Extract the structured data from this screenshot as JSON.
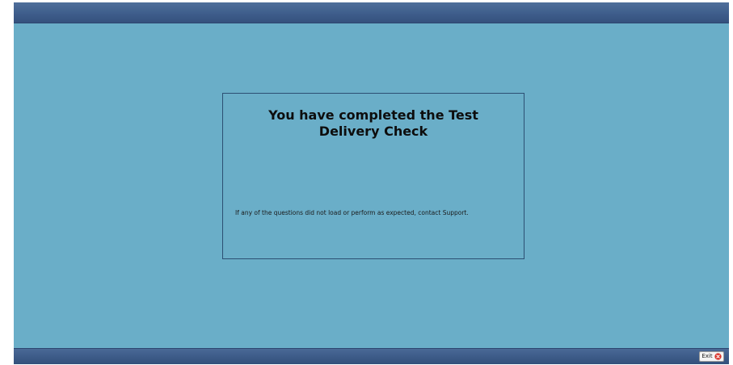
{
  "message": {
    "title": "You have completed the Test Delivery Check",
    "body": "If any of the questions did not load or perform as expected, contact Support."
  },
  "footer": {
    "exit_label": "Exit",
    "exit_icon": "close-circle-icon"
  },
  "colors": {
    "background": "#6aaec8",
    "bar": "#3d5c8a",
    "exit_icon": "#d9342b"
  }
}
